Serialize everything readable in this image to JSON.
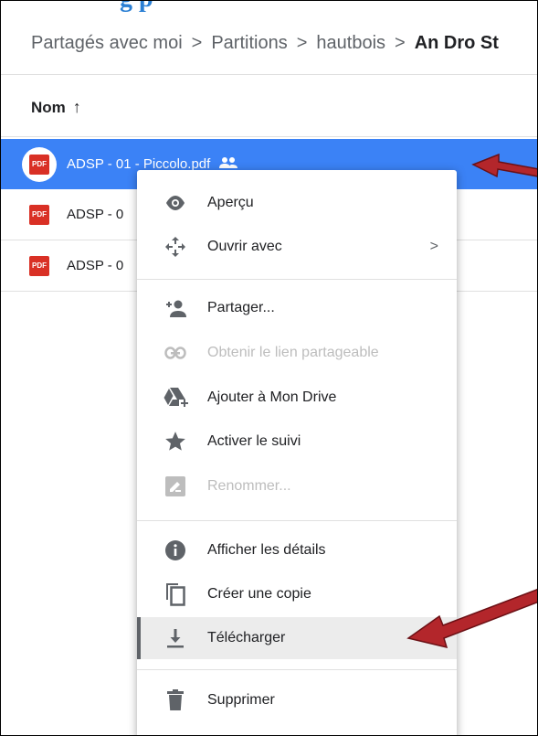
{
  "top_clipped_text": "g  p",
  "breadcrumb": {
    "items": [
      "Partagés avec moi",
      "Partitions",
      "hautbois"
    ],
    "current": "An Dro St",
    "separator": ">"
  },
  "column_header": {
    "label": "Nom",
    "sort_arrow": "↑"
  },
  "files": [
    {
      "name": "ADSP - 01 - Piccolo.pdf",
      "badge": "PDF"
    },
    {
      "name": "ADSP - 0",
      "badge": "PDF"
    },
    {
      "name": "ADSP - 0",
      "badge": "PDF"
    }
  ],
  "context_menu": {
    "items": [
      {
        "label": "Aperçu",
        "icon": "eye-icon"
      },
      {
        "label": "Ouvrir avec",
        "icon": "move-icon",
        "submenu": ">"
      },
      {
        "label": "Partager...",
        "icon": "add-person-icon"
      },
      {
        "label": "Obtenir le lien partageable",
        "icon": "link-icon"
      },
      {
        "label": "Ajouter à Mon Drive",
        "icon": "drive-add-icon"
      },
      {
        "label": "Activer le suivi",
        "icon": "star-icon"
      },
      {
        "label": "Renommer...",
        "icon": "rename-icon"
      },
      {
        "label": "Afficher les détails",
        "icon": "info-icon"
      },
      {
        "label": "Créer une copie",
        "icon": "copy-icon"
      },
      {
        "label": "Télécharger",
        "icon": "download-icon"
      },
      {
        "label": "Supprimer",
        "icon": "trash-icon"
      }
    ]
  },
  "colors": {
    "selected_row": "#3b82f6",
    "pdf_red": "#d93025",
    "annotation_arrow": "#b3262b"
  }
}
